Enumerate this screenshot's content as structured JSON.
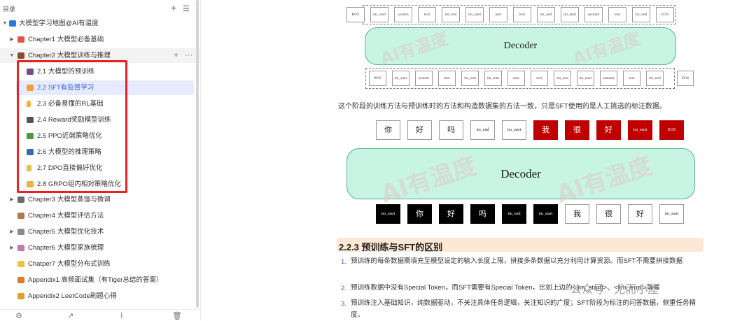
{
  "sidebar": {
    "title": "目录",
    "root": {
      "label": "大模型学习地图@AI有温度"
    },
    "chapters": [
      {
        "label": "Chapter1 大模型必备基础"
      },
      {
        "label": "Chapter2 大模型训练与推理"
      },
      {
        "label": "Chapter3 大模型蒸馏与微调"
      },
      {
        "label": "Chapter4 大模型评估方法"
      },
      {
        "label": "Chapter5 大模型优化技术"
      },
      {
        "label": "Chapter6 大模型家族梳理"
      },
      {
        "label": "Chatper7 大模型分布式训练"
      },
      {
        "label": "Appendix1 高频面试集（有Tiger总结的答案）"
      },
      {
        "label": "Appendix2 LeetCode刷题心得"
      }
    ],
    "sub_items": [
      {
        "label": "2.1 大模型的预训练"
      },
      {
        "label": "2.2 SFT有监督学习"
      },
      {
        "label": "2.3 必备易懂的RL基础"
      },
      {
        "label": "2.4 Reward奖励模型训练"
      },
      {
        "label": "2.5 PPO近端策略优化"
      },
      {
        "label": "2.6 大模型的推理策略"
      },
      {
        "label": "2.7 DPO直接偏好优化"
      },
      {
        "label": "2.8 GRPO组内相对策略优化"
      }
    ],
    "active_item": "2.2 SFT有监督学习"
  },
  "figure1": {
    "top_tokens": [
      "BOS",
      "im_start",
      "system",
      "text",
      "im_end",
      "im_start",
      "user",
      "text",
      "im_end",
      "im_start",
      "assitant",
      "text",
      "im_end",
      "EOS"
    ],
    "decoder_label": "Decoder",
    "bottom_tokens": [
      "BOS",
      "im_start",
      "system",
      "text",
      "im_end",
      "im_start",
      "user",
      "text",
      "im_end",
      "im_start",
      "assitant",
      "text",
      "im_end"
    ],
    "eos_label": "EOS",
    "watermark": "AI有温度"
  },
  "paragraph": "这个阶段的训练方法与预训练时的方法和构造数据集的方法一致，只是SFT使用的是人工挑选的标注数据。",
  "figure2": {
    "top_tokens": [
      {
        "text": "你",
        "style": "white"
      },
      {
        "text": "好",
        "style": "white"
      },
      {
        "text": "吗",
        "style": "white"
      },
      {
        "text": "im_end",
        "style": "white"
      },
      {
        "text": "im_start",
        "style": "white"
      },
      {
        "text": "我",
        "style": "red"
      },
      {
        "text": "很",
        "style": "red"
      },
      {
        "text": "好",
        "style": "red"
      },
      {
        "text": "im_start",
        "style": "red"
      },
      {
        "text": "EOS",
        "style": "red"
      }
    ],
    "decoder_label": "Decoder",
    "bottom_tokens": [
      {
        "text": "im_start",
        "style": "black"
      },
      {
        "text": "你",
        "style": "black"
      },
      {
        "text": "好",
        "style": "black"
      },
      {
        "text": "吗",
        "style": "black"
      },
      {
        "text": "im_end",
        "style": "black"
      },
      {
        "text": "im_start",
        "style": "black"
      },
      {
        "text": "我",
        "style": "white"
      },
      {
        "text": "很",
        "style": "white"
      },
      {
        "text": "好",
        "style": "white"
      },
      {
        "text": "im_start",
        "style": "white"
      }
    ],
    "watermark": "AI有温度"
  },
  "section": {
    "heading": "2.2.3 预训练与SFT的区别",
    "items": [
      {
        "num": "1.",
        "text": "预训练的每条数据需填充至模型设定的输入长度上限，拼接多条数据以充分利用计算资源。而SFT不需要拼接数据"
      },
      {
        "num": "2.",
        "text": "预训练数据中没有Special Token，而SFT需要有Special Token，比如上边的<|im_start|>、<|im_end|>等等"
      },
      {
        "num": "3.",
        "text": "预训练注入基础知识，纯数据驱动，不关注具体任务逻辑，关注知识的广度；SFT阶段为标注的问答数据，侧重任务精度。"
      }
    ]
  },
  "wechat_watermark": "公众号 · 尤而小屋",
  "colors": {
    "accent": "#3b5bdb",
    "highlight_box": "#e8231f",
    "decoder_fill": "#c8f4e4",
    "token_red": "#c00000"
  }
}
